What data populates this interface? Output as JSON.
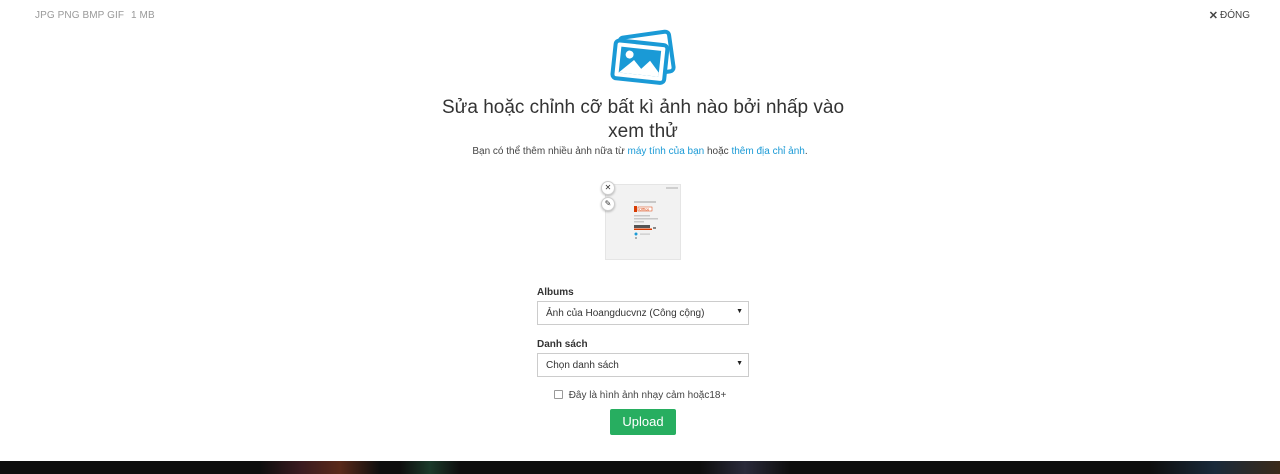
{
  "header": {
    "formats": "JPG PNG BMP GIF",
    "max_size": "1 MB",
    "close_label": "ĐÓNG"
  },
  "main": {
    "title": "Sửa hoặc chỉnh cỡ bất kì ảnh nào bởi nhấp vào xem thử",
    "subtitle_prefix": "Bạn có thể thêm nhiều ảnh nữa từ ",
    "subtitle_link_computer": "máy tính của bạn",
    "subtitle_middle": " hoặc ",
    "subtitle_link_url": "thêm địa chỉ ảnh",
    "subtitle_suffix": ".",
    "thumbnail": {
      "remove_icon": "close-icon",
      "edit_icon": "pencil-icon",
      "preview_brand": "Office"
    }
  },
  "form": {
    "albums_label": "Albums",
    "albums_value": "Ảnh của Hoangducvnz (Công cộng)",
    "list_label": "Danh sách",
    "list_value": "Chọn danh sách",
    "sensitive_label": "Đây là hình ảnh nhạy cảm hoặc18+",
    "sensitive_checked": false,
    "upload_label": "Upload"
  },
  "colors": {
    "accent": "#1a9ad6",
    "upload": "#27ae60",
    "office": "#d83b01"
  }
}
